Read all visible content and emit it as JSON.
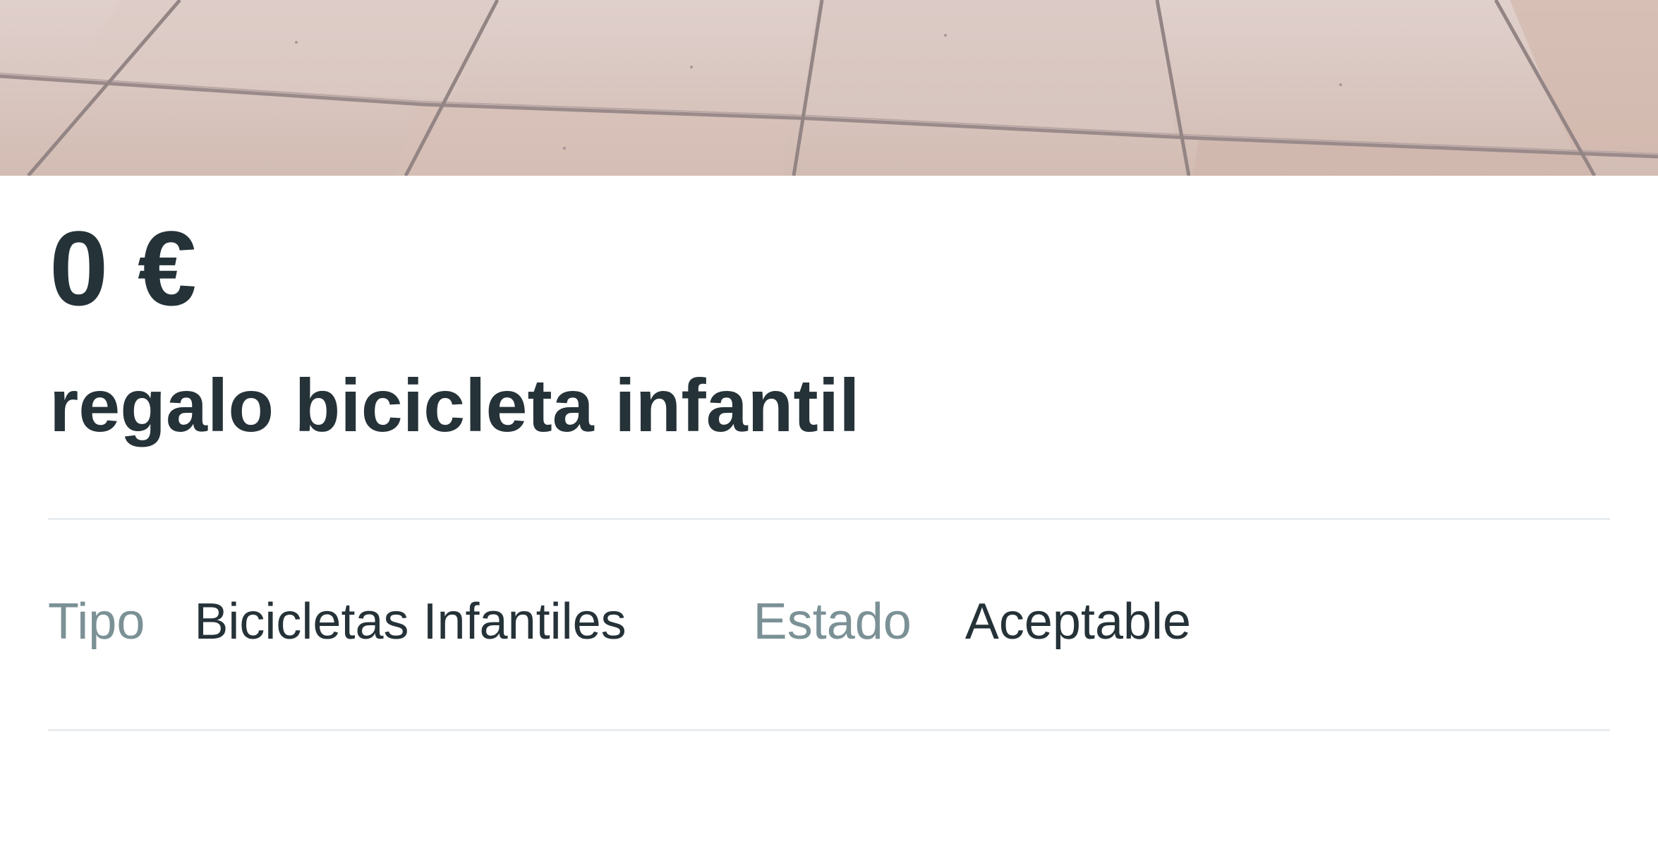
{
  "listing": {
    "photo_icon": "product-photo",
    "price": "0 €",
    "title": "regalo bicicleta infantil",
    "attributes": [
      {
        "label": "Tipo",
        "value": "Bicicletas Infantiles"
      },
      {
        "label": "Estado",
        "value": "Aceptable"
      }
    ]
  },
  "colors": {
    "text_primary": "#253238",
    "text_secondary": "#7b9196",
    "divider": "#e9ecef",
    "background": "#ffffff"
  }
}
